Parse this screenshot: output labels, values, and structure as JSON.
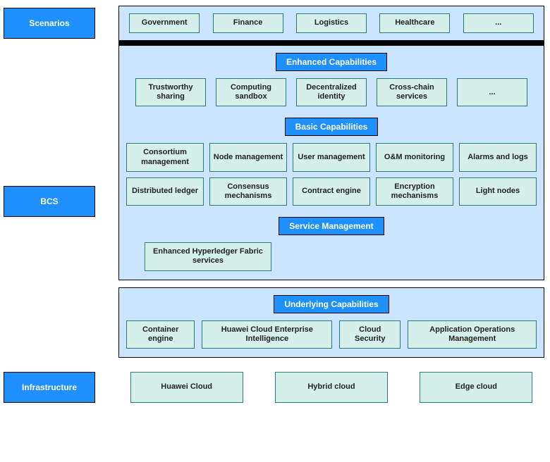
{
  "side": {
    "scenarios": "Scenarios",
    "bcs": "BCS",
    "infra": "Infrastructure"
  },
  "scenarios": {
    "items": [
      "Government",
      "Finance",
      "Logistics",
      "Healthcare",
      "..."
    ]
  },
  "bcs": {
    "enhanced_header": "Enhanced Capabilities",
    "enhanced": [
      "Trustworthy sharing",
      "Computing sandbox",
      "Decentralized identity",
      "Cross-chain services",
      "..."
    ],
    "basic_header": "Basic Capabilities",
    "basic_row1": [
      "Consortium management",
      "Node management",
      "User management",
      "O&M monitoring",
      "Alarms and logs"
    ],
    "basic_row2": [
      "Distributed ledger",
      "Consensus mechanisms",
      "Contract engine",
      "Encryption mechanisms",
      "Light nodes"
    ],
    "service_header": "Service Management",
    "fabric": "Enhanced Hyperledger Fabric services"
  },
  "underlying": {
    "header": "Underlying Capabilities",
    "items": [
      "Container engine",
      "Huawei Cloud Enterprise Intelligence",
      "Cloud Security",
      "Application Operations Management"
    ]
  },
  "infra": {
    "items": [
      "Huawei Cloud",
      "Hybrid cloud",
      "Edge cloud"
    ]
  }
}
